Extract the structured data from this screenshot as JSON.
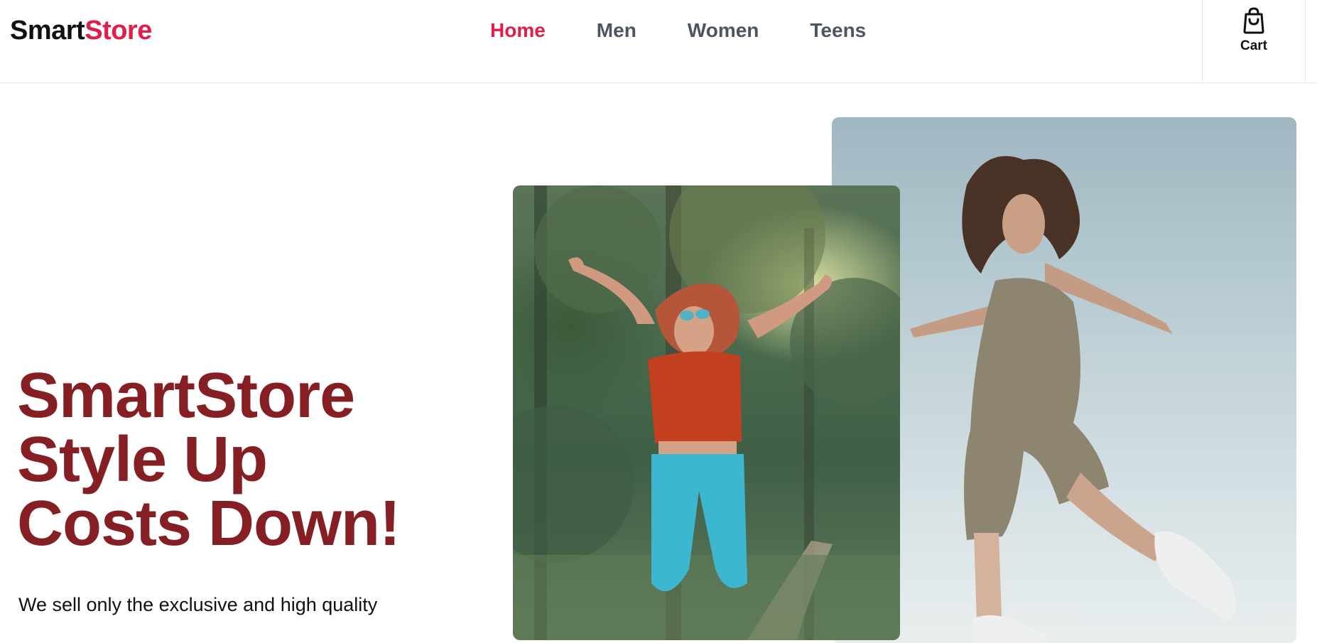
{
  "header": {
    "logo_part1": "Smart",
    "logo_part2": "Store",
    "nav": [
      {
        "label": "Home",
        "active": true
      },
      {
        "label": "Men",
        "active": false
      },
      {
        "label": "Women",
        "active": false
      },
      {
        "label": "Teens",
        "active": false
      }
    ],
    "cart": {
      "label": "Cart",
      "icon": "shopping-bag-icon"
    }
  },
  "hero": {
    "title_lines": [
      "SmartStore",
      "Style Up",
      "Costs Down!"
    ],
    "subtitle": "We sell only the exclusive and high quality"
  },
  "images": [
    {
      "name": "hero-image-forest-jump"
    },
    {
      "name": "hero-image-sky-jump"
    }
  ],
  "colors": {
    "accent": "#e11d48",
    "title": "#861f24",
    "nav_text": "#4b5563",
    "border": "#e5e7eb"
  }
}
